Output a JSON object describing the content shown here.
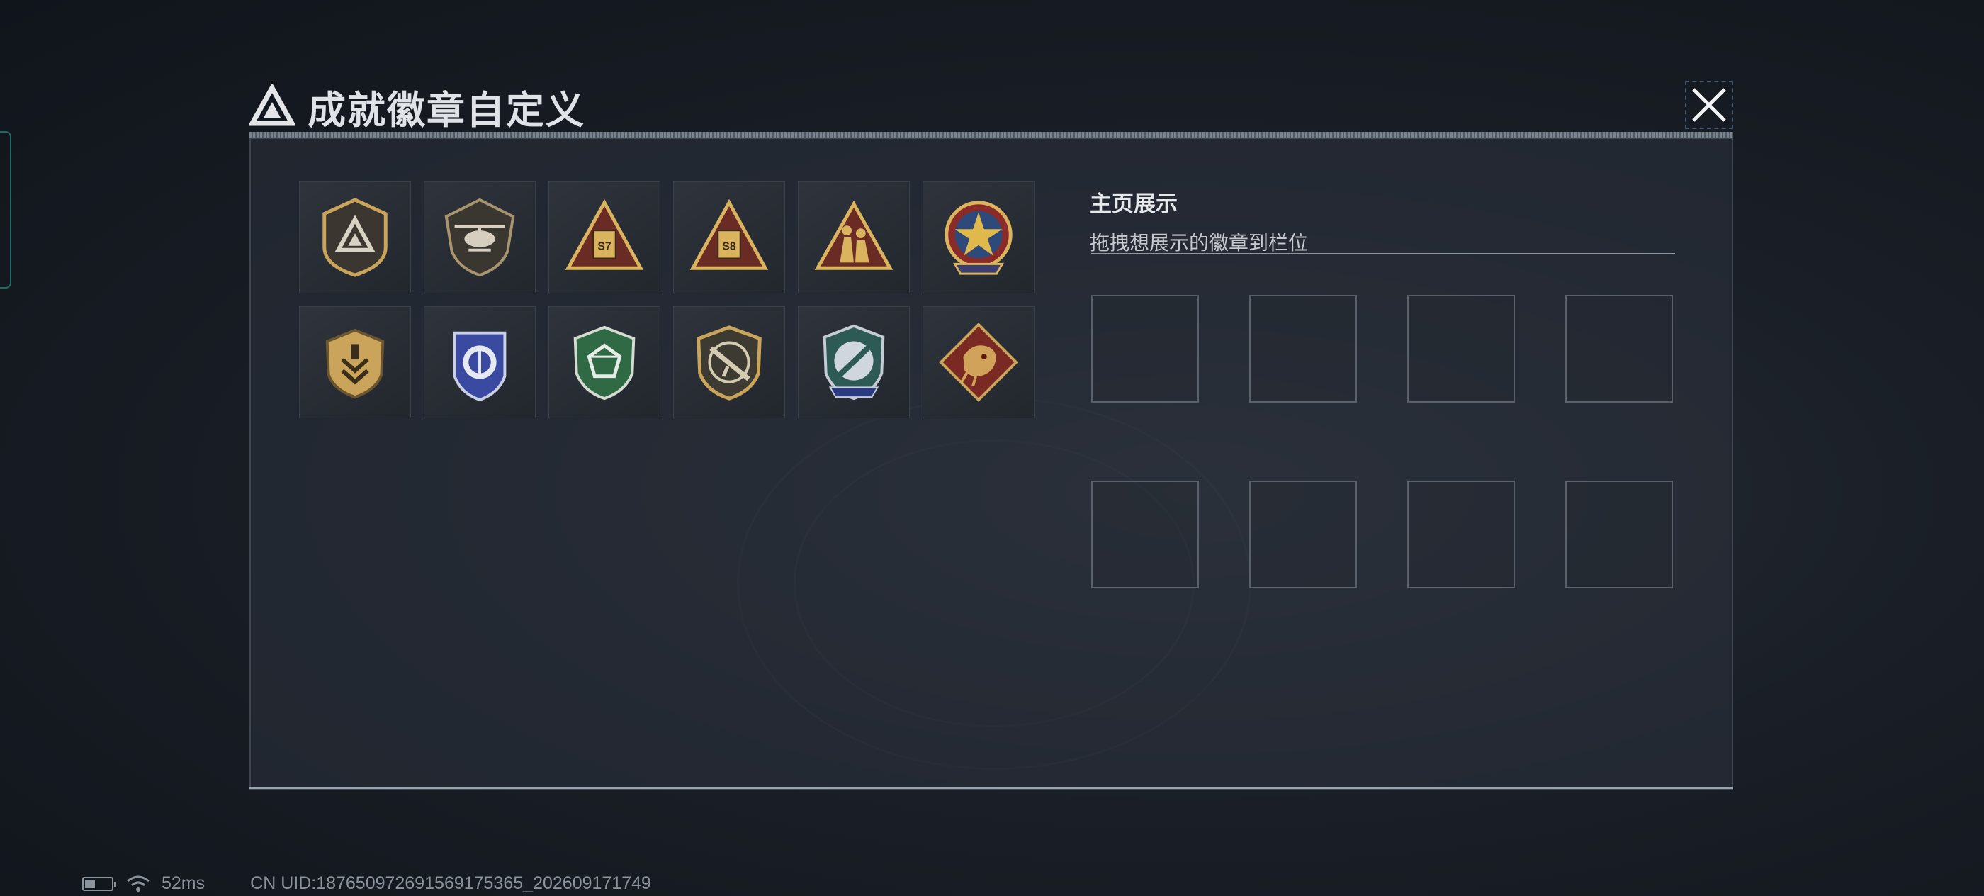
{
  "title": "成就徽章自定义",
  "close_icon": "close-icon",
  "badges": [
    {
      "name": "delta-badge",
      "icon": "delta-shield"
    },
    {
      "name": "helicopter-badge",
      "icon": "helicopter-shield"
    },
    {
      "name": "s7-badge",
      "icon": "triangle-s7",
      "label": "S7"
    },
    {
      "name": "s8-badge",
      "icon": "triangle-s8",
      "label": "S8"
    },
    {
      "name": "squad-badge",
      "icon": "triangle-soldiers"
    },
    {
      "name": "star-wreath-badge",
      "icon": "star-medal"
    },
    {
      "name": "chevron-shield-badge",
      "icon": "gold-shield"
    },
    {
      "name": "blue-crest-badge",
      "icon": "blue-crest"
    },
    {
      "name": "green-gem-badge",
      "icon": "green-shield"
    },
    {
      "name": "rifle-badge",
      "icon": "rifle-shield"
    },
    {
      "name": "knife-crest-badge",
      "icon": "knife-crest"
    },
    {
      "name": "dragon-badge",
      "icon": "dragon-diamond"
    }
  ],
  "display": {
    "title": "主页展示",
    "subtitle": "拖拽想展示的徽章到栏位",
    "slot_count": 8
  },
  "status": {
    "battery_level": 0.4,
    "ping": "52ms",
    "uid": "CN UID:18765097269156917536​5_202609171749"
  },
  "colors": {
    "gold": "#c9a45a",
    "accent_teal": "#1e6b62",
    "panel_border": "#9aa3ad"
  }
}
